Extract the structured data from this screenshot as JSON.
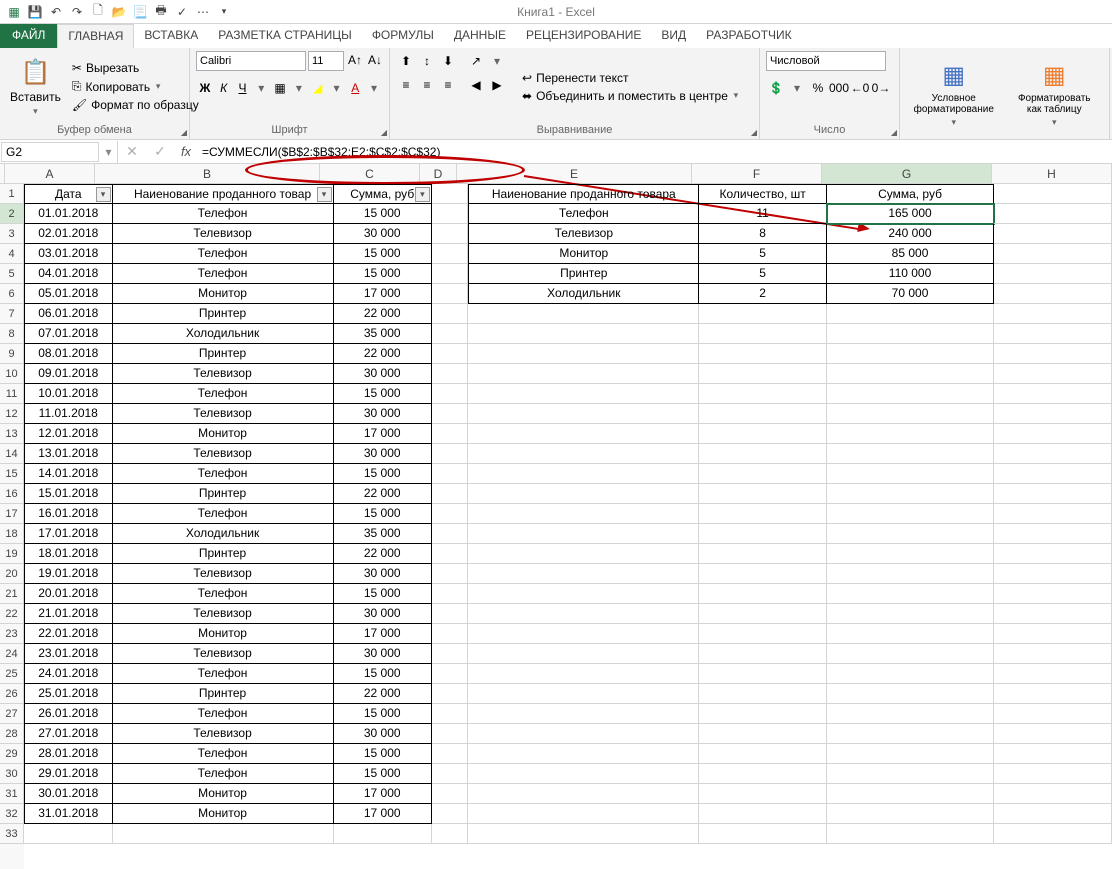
{
  "title": "Книга1 - Excel",
  "qat_icons": [
    "excel-icon",
    "save-icon",
    "undo-icon",
    "redo-icon",
    "new-icon",
    "open-icon",
    "print-preview-icon",
    "quick-print-icon",
    "spelling-icon",
    "sort-icon"
  ],
  "tabs": {
    "file": "ФАЙЛ",
    "items": [
      "ГЛАВНАЯ",
      "ВСТАВКА",
      "РАЗМЕТКА СТРАНИЦЫ",
      "ФОРМУЛЫ",
      "ДАННЫЕ",
      "РЕЦЕНЗИРОВАНИЕ",
      "ВИД",
      "РАЗРАБОТЧИК"
    ],
    "active": 0
  },
  "ribbon": {
    "clipboard": {
      "label": "Буфер обмена",
      "paste": "Вставить",
      "cut": "Вырезать",
      "copy": "Копировать",
      "fmt": "Формат по образцу"
    },
    "font": {
      "label": "Шрифт",
      "name": "Calibri",
      "size": "11"
    },
    "align": {
      "label": "Выравнивание",
      "wrap": "Перенести текст",
      "merge": "Объединить и поместить в центре"
    },
    "number": {
      "label": "Число",
      "format": "Числовой"
    },
    "styles": {
      "cond": "Условное форматирование",
      "table": "Форматировать как таблицу"
    }
  },
  "formulabar": {
    "cell": "G2",
    "formula": "=СУММЕСЛИ($B$2:$B$32;E2;$C$2:$C$32)"
  },
  "cols": [
    "A",
    "B",
    "C",
    "D",
    "E",
    "F",
    "G",
    "H"
  ],
  "headers1": {
    "A": "Дата",
    "B": "Наиенование проданного товар",
    "C": "Сумма, руб"
  },
  "headers2": {
    "E": "Наиенование проданного товара",
    "F": "Количество, шт",
    "G": "Сумма, руб"
  },
  "table1": [
    [
      "01.01.2018",
      "Телефон",
      "15 000"
    ],
    [
      "02.01.2018",
      "Телевизор",
      "30 000"
    ],
    [
      "03.01.2018",
      "Телефон",
      "15 000"
    ],
    [
      "04.01.2018",
      "Телефон",
      "15 000"
    ],
    [
      "05.01.2018",
      "Монитор",
      "17 000"
    ],
    [
      "06.01.2018",
      "Принтер",
      "22 000"
    ],
    [
      "07.01.2018",
      "Холодильник",
      "35 000"
    ],
    [
      "08.01.2018",
      "Принтер",
      "22 000"
    ],
    [
      "09.01.2018",
      "Телевизор",
      "30 000"
    ],
    [
      "10.01.2018",
      "Телефон",
      "15 000"
    ],
    [
      "11.01.2018",
      "Телевизор",
      "30 000"
    ],
    [
      "12.01.2018",
      "Монитор",
      "17 000"
    ],
    [
      "13.01.2018",
      "Телевизор",
      "30 000"
    ],
    [
      "14.01.2018",
      "Телефон",
      "15 000"
    ],
    [
      "15.01.2018",
      "Принтер",
      "22 000"
    ],
    [
      "16.01.2018",
      "Телефон",
      "15 000"
    ],
    [
      "17.01.2018",
      "Холодильник",
      "35 000"
    ],
    [
      "18.01.2018",
      "Принтер",
      "22 000"
    ],
    [
      "19.01.2018",
      "Телевизор",
      "30 000"
    ],
    [
      "20.01.2018",
      "Телефон",
      "15 000"
    ],
    [
      "21.01.2018",
      "Телевизор",
      "30 000"
    ],
    [
      "22.01.2018",
      "Монитор",
      "17 000"
    ],
    [
      "23.01.2018",
      "Телевизор",
      "30 000"
    ],
    [
      "24.01.2018",
      "Телефон",
      "15 000"
    ],
    [
      "25.01.2018",
      "Принтер",
      "22 000"
    ],
    [
      "26.01.2018",
      "Телефон",
      "15 000"
    ],
    [
      "27.01.2018",
      "Телевизор",
      "30 000"
    ],
    [
      "28.01.2018",
      "Телефон",
      "15 000"
    ],
    [
      "29.01.2018",
      "Телефон",
      "15 000"
    ],
    [
      "30.01.2018",
      "Монитор",
      "17 000"
    ],
    [
      "31.01.2018",
      "Монитор",
      "17 000"
    ]
  ],
  "table2": [
    [
      "Телефон",
      "11",
      "165 000"
    ],
    [
      "Телевизор",
      "8",
      "240 000"
    ],
    [
      "Монитор",
      "5",
      "85 000"
    ],
    [
      "Принтер",
      "5",
      "110 000"
    ],
    [
      "Холодильник",
      "2",
      "70 000"
    ]
  ]
}
